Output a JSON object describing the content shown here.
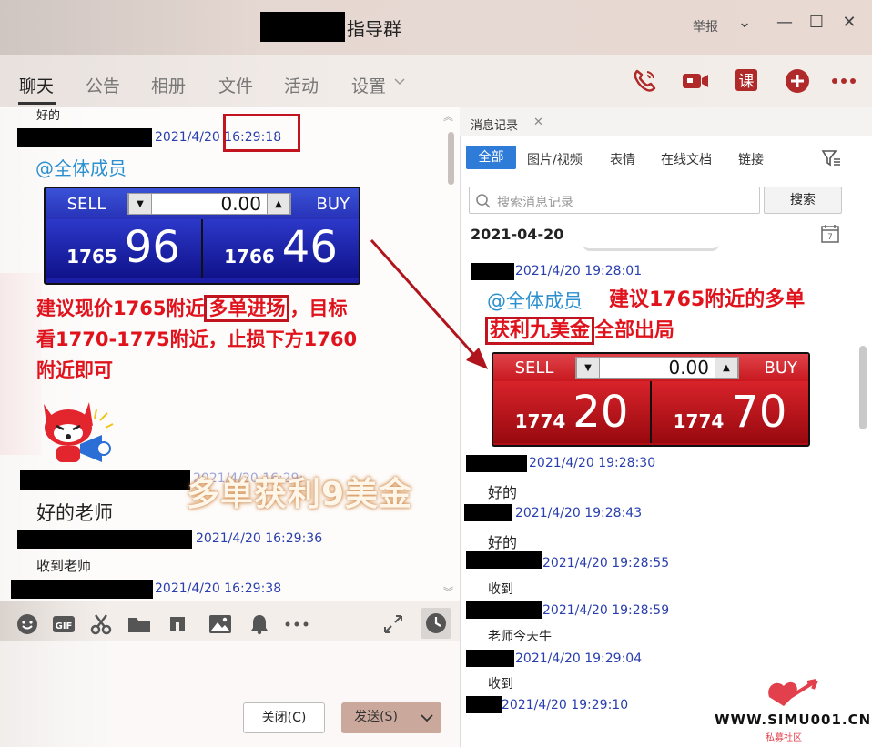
{
  "window": {
    "title": "指导群",
    "report_label": "举报",
    "controls": [
      "⌄",
      "—",
      "☐",
      "✕"
    ]
  },
  "tabs": [
    {
      "label": "聊天",
      "active": true
    },
    {
      "label": "公告"
    },
    {
      "label": "相册"
    },
    {
      "label": "文件"
    },
    {
      "label": "活动"
    },
    {
      "label": "设置"
    }
  ],
  "header_icons": [
    "phone-icon",
    "video-call-icon",
    "lesson-icon",
    "add-icon",
    "more-icon"
  ],
  "header": {
    "lesson_glyph": "课"
  },
  "chat": {
    "m0_text": "好的",
    "m1_time": "2021/4/20 16:29:18",
    "m1_mention": "@全体成员",
    "quote1": {
      "sell": "SELL",
      "buy": "BUY",
      "qty": "0.00",
      "sell_small": "1765",
      "sell_big": "96",
      "buy_small": "1766",
      "buy_big": "46"
    },
    "m1_text_l1a": "建议现价1765附近",
    "m1_text_l1b": "多单进场",
    "m1_text_l1c": "，目标",
    "m1_text_l2": "看1770-1775附近，止损下方1760",
    "m1_text_l3": "附近即可",
    "m2_time": "2021/4/20 16:29:",
    "watermark": "多单获利9美金",
    "m2_text": "好的老师",
    "m3_time": "2021/4/20 16:29:36",
    "m3_text": "收到老师",
    "m4_time": "2021/4/20 16:29:38"
  },
  "toolbar": [
    "emoji-icon",
    "gif-icon",
    "scissors-icon",
    "folder-icon",
    "music-icon",
    "image-icon",
    "bell-icon",
    "more-icon"
  ],
  "toolbar_gif": "GIF",
  "buttons": {
    "close": "关闭(C)",
    "send": "发送(S)"
  },
  "history": {
    "tab_label": "消息记录",
    "filters": [
      "全部",
      "图片/视频",
      "表情",
      "在线文档",
      "链接"
    ],
    "search_placeholder": "搜索消息记录",
    "search_button": "搜索",
    "date": "2021-04-20",
    "calendar_glyph": "7",
    "r1_time": "2021/4/20 19:28:01",
    "r1_mention": "@全体成员",
    "r1_text_a": "建议1765附近的多单",
    "r1_text_b": "获利九美金",
    "r1_text_c": "全部出局",
    "quote2": {
      "sell": "SELL",
      "buy": "BUY",
      "qty": "0.00",
      "sell_small": "1774",
      "sell_big": "20",
      "buy_small": "1774",
      "buy_big": "70"
    },
    "messages": [
      {
        "time": "2021/4/20 19:28:30",
        "text": "好的"
      },
      {
        "time": "2021/4/20 19:28:43",
        "text": "好的"
      },
      {
        "time": "2021/4/20 19:28:55",
        "text": "收到"
      },
      {
        "time": "2021/4/20 19:28:59",
        "text": "老师今天牛"
      },
      {
        "time": "2021/4/20 19:29:04",
        "text": "收到"
      },
      {
        "time": "2021/4/20 19:29:10",
        "text": ""
      }
    ]
  },
  "logo": {
    "url": "WWW.SIMU001.CN",
    "sub": "私募社区"
  },
  "colors": {
    "accent": "#2f7bd8",
    "alert": "#e0131d",
    "timestamp": "#2a3fae"
  }
}
